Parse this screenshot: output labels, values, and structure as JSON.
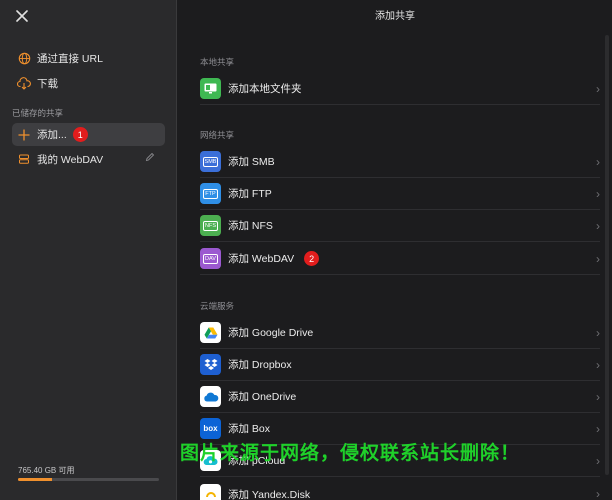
{
  "sidebar": {
    "items": [
      {
        "label": "通过直接 URL",
        "icon": "globe-icon"
      },
      {
        "label": "下载",
        "icon": "cloud-download-icon"
      }
    ],
    "saved_section": "已储存的共享",
    "add_label": "添加...",
    "add_badge": "1",
    "webdav_label": "我的 WebDAV",
    "storage_text": "765.40 GB 可用",
    "storage_fraction": 0.24
  },
  "main": {
    "title": "添加共享",
    "sections": {
      "local": "本地共享",
      "network": "网络共享",
      "cloud": "云端服务"
    },
    "local_rows": [
      {
        "label": "添加本地文件夹"
      }
    ],
    "network_rows": [
      {
        "label": "添加 SMB",
        "tile": "SMB"
      },
      {
        "label": "添加 FTP",
        "tile": "FTP"
      },
      {
        "label": "添加 NFS",
        "tile": "NFS"
      },
      {
        "label": "添加 WebDAV",
        "tile": "DAV",
        "badge": "2"
      }
    ],
    "cloud_rows": [
      {
        "label": "添加 Google Drive"
      },
      {
        "label": "添加 Dropbox"
      },
      {
        "label": "添加 OneDrive"
      },
      {
        "label": "添加 Box",
        "tile": "box"
      },
      {
        "label": "添加 pCloud"
      },
      {
        "label": "添加 Yandex.Disk"
      }
    ]
  },
  "watermark": "图片来源于网络，侵权联系站长删除！",
  "colors": {
    "accent": "#f0902d",
    "badge": "#e21d1d",
    "watermark": "#1fd12a"
  }
}
